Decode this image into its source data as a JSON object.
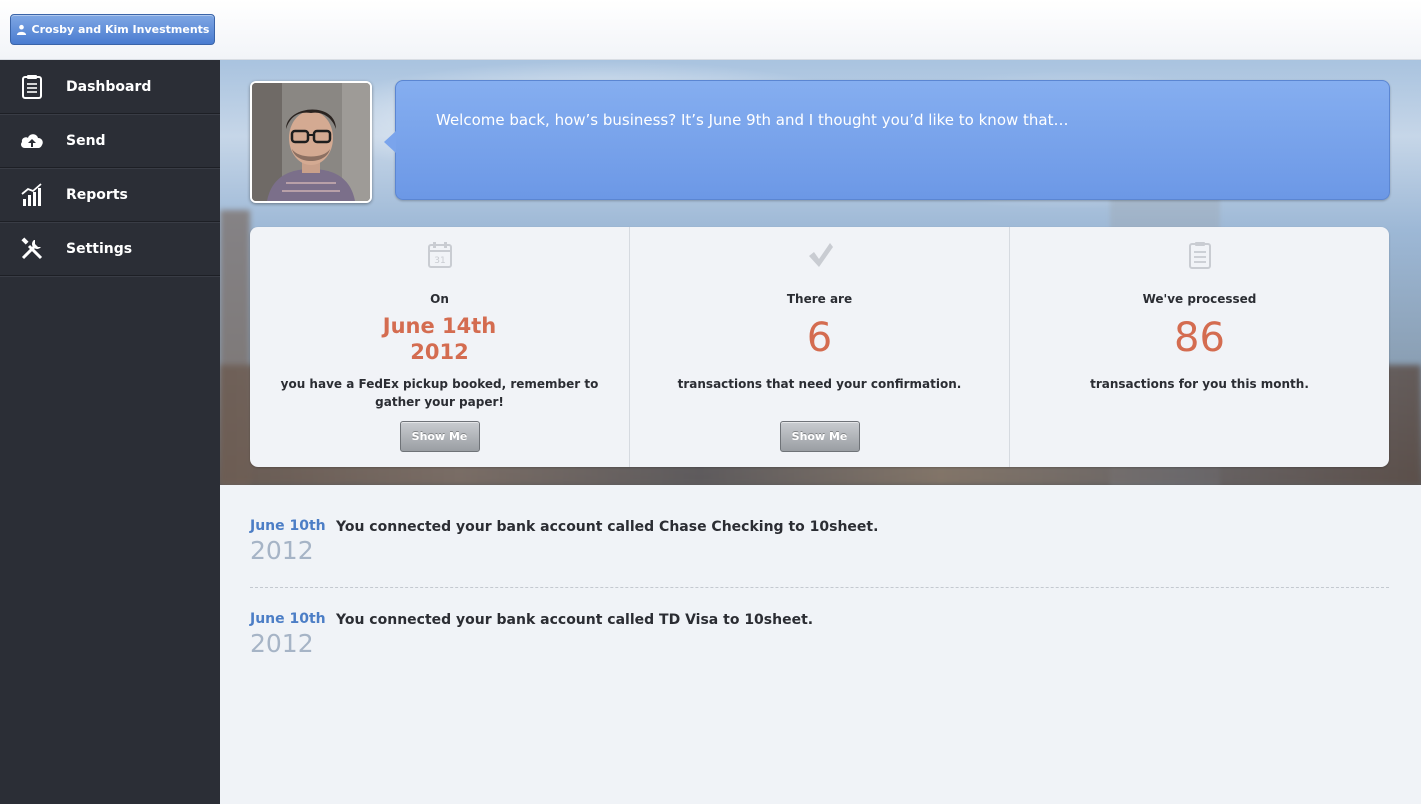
{
  "topbar": {
    "account_label": "Crosby and Kim Investments"
  },
  "sidebar": {
    "items": [
      {
        "label": "Dashboard",
        "icon": "dashboard-clipboard-icon"
      },
      {
        "label": "Send",
        "icon": "cloud-upload-icon"
      },
      {
        "label": "Reports",
        "icon": "chart-icon"
      },
      {
        "label": "Settings",
        "icon": "tools-icon"
      }
    ]
  },
  "hero": {
    "welcome": "Welcome back, how’s business? It’s June 9th and I thought you’d like to know that…"
  },
  "cards": [
    {
      "icon": "calendar-icon",
      "icon_text": "31",
      "intro": "On",
      "date_line1": "June 14th",
      "date_line2": "2012",
      "desc": "you have a FedEx pickup booked, remember to gather your paper!",
      "button": "Show Me"
    },
    {
      "icon": "checkmark-icon",
      "intro": "There are",
      "number": "6",
      "desc": "transactions that need your confirmation.",
      "button": "Show Me"
    },
    {
      "icon": "clipboard-icon",
      "intro": "We've processed",
      "number": "86",
      "desc": "transactions for you this month."
    }
  ],
  "feed": [
    {
      "date": "June 10th",
      "year": "2012",
      "text": "You connected your bank account called Chase Checking to 10sheet."
    },
    {
      "date": "June 10th",
      "year": "2012",
      "text": "You connected your bank account called TD Visa to 10sheet."
    }
  ],
  "colors": {
    "accent_blue": "#6c98e6",
    "highlight": "#d46c50",
    "sidebar": "#2b2e36"
  }
}
